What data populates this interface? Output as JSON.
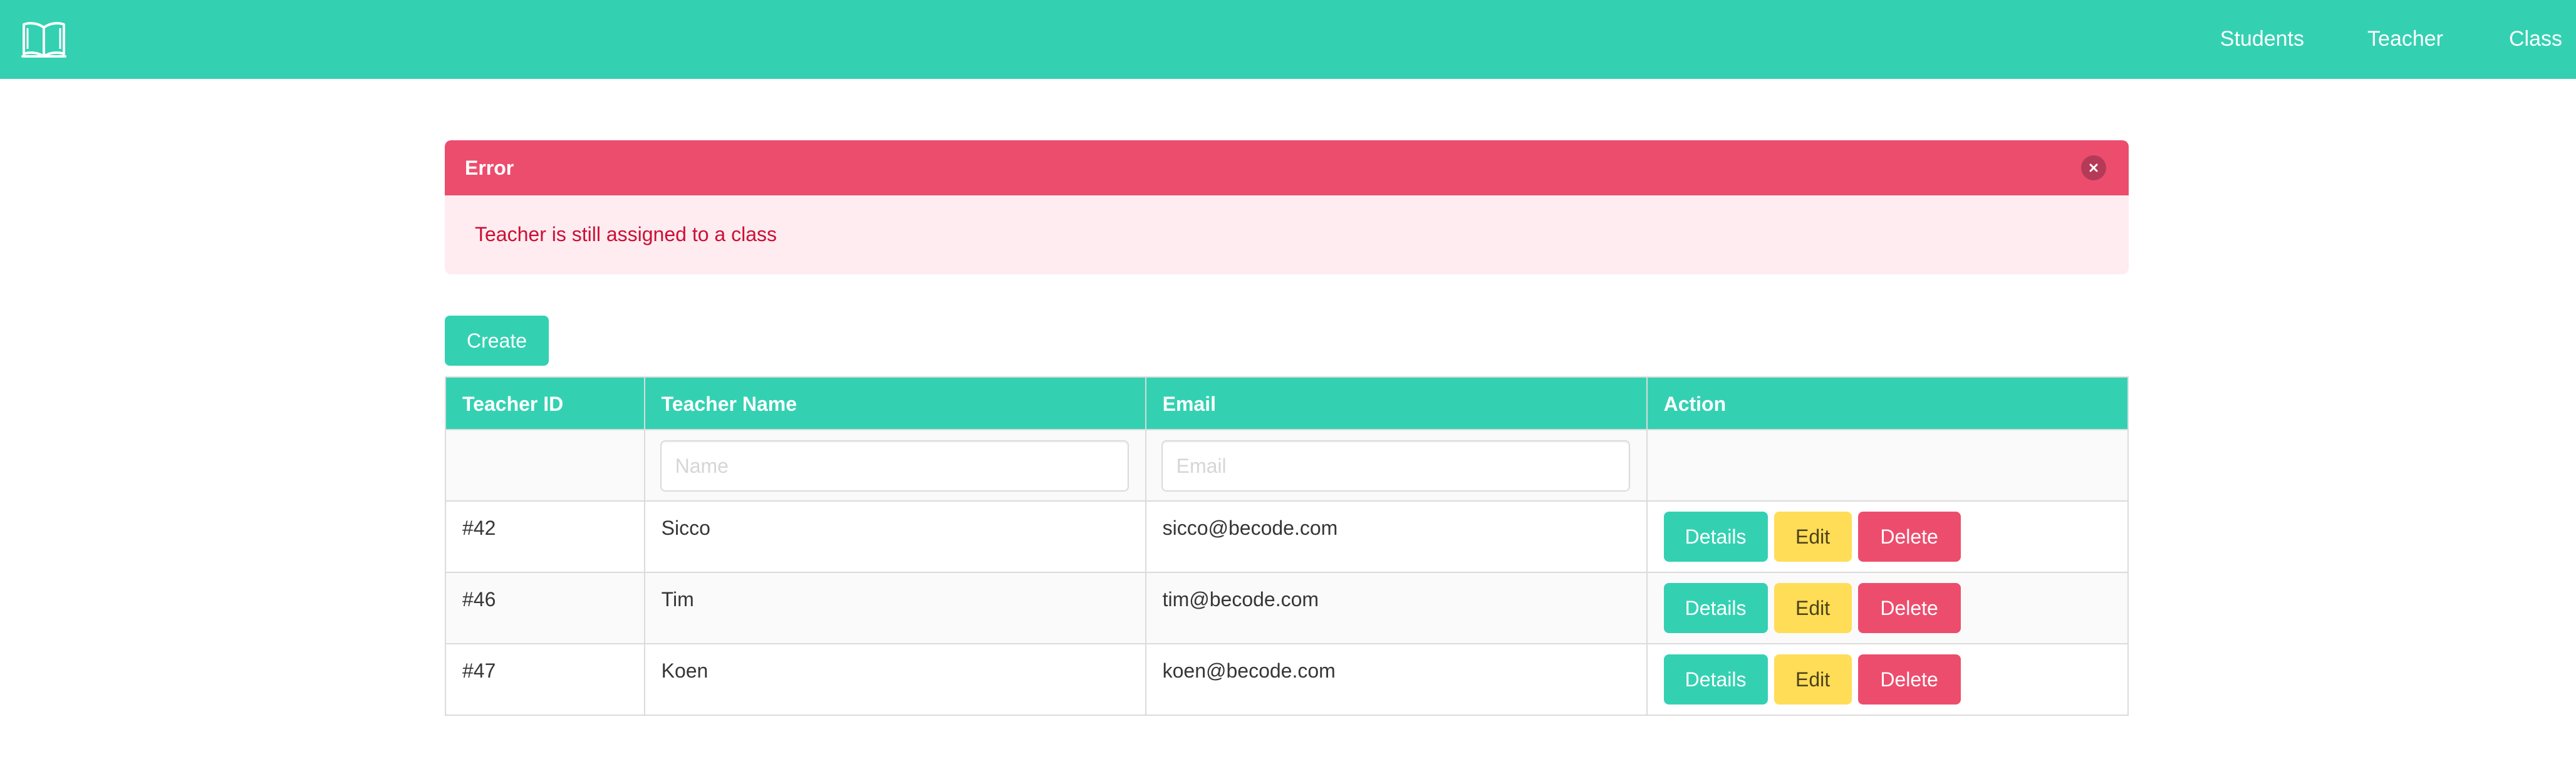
{
  "navbar": {
    "logo_icon": "open-book-icon",
    "links": [
      "Students",
      "Teacher",
      "Class"
    ],
    "color": "#33d1b2"
  },
  "message": {
    "title": "Error",
    "body": "Teacher is still assigned to a class",
    "close_icon": "close-icon",
    "color": "#ed4d6d"
  },
  "create_label": "Create",
  "table": {
    "headers": [
      "Teacher ID",
      "Teacher Name",
      "Email",
      "Action"
    ],
    "filters": {
      "name_placeholder": "Name",
      "email_placeholder": "Email"
    },
    "rows": [
      {
        "id": "#42",
        "name": "Sicco",
        "email": "sicco@becode.com"
      },
      {
        "id": "#46",
        "name": "Tim",
        "email": "tim@becode.com"
      },
      {
        "id": "#47",
        "name": "Koen",
        "email": "koen@becode.com"
      }
    ],
    "actions": {
      "details": "Details",
      "edit": "Edit",
      "delete": "Delete"
    }
  }
}
